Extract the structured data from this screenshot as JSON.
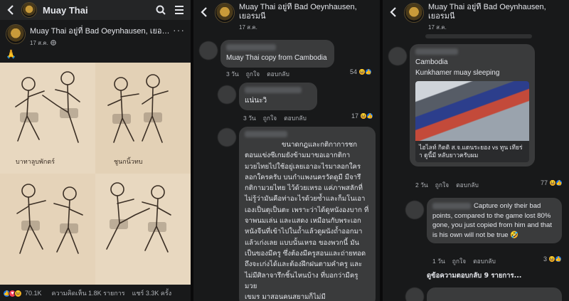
{
  "panel1": {
    "app_title": "Muay Thai",
    "post": {
      "author": "Muay Thai อยู่ที่ Bad Oeynhausen, เยอรมนี",
      "date": "17 ส.ค.",
      "caption": "🙏",
      "art_labels": [
        "บาทาลูบพักตร์",
        "ชูนกนิ้วทบ"
      ]
    },
    "stats": {
      "reactions": "70.1K",
      "comments": "ความคิดเห็น 1.8K รายการ",
      "shares": "แชร์ 3.3K ครั้ง"
    }
  },
  "panel2": {
    "page_name": "Muay Thai อยู่ที่ Bad Oeynhausen, เยอรมนี",
    "date": "17 ส.ค.",
    "comments": [
      {
        "text": "Muay Thai copy from Cambodia",
        "time": "3 วัน",
        "like": "ถูกใจ",
        "reply": "ตอบกลับ",
        "count": "54"
      },
      {
        "text": "แน่นะวิ",
        "time": "3 วัน",
        "like": "ถูกใจ",
        "reply": "ตอบกลับ",
        "count": "17"
      },
      {
        "lines": [
          "ขนาดกฎและกติกาการชก",
          "ตอนแข่งซีเกมยังข้ามมาขอเอากติกา",
          "มวยไทยไปใช้อยู่เลยเอาอะไรมาลอกใคร",
          "ลอกใครครับ บนกำแพงนครวัดดูมี มีจารึ",
          "กติกามวยไทย ไว้ด้วยเหรอ แค่ภาพสลักที่",
          "ไม่รู้ว่ามันคือท่าอะไรด้วยซ้ำและก็มโนเอา",
          "เองเป็นตุเป็นตะ เพราะว่าได้ดูหนังองบาก ที่",
          "จาพนมเล่น และแสดง เหมือนกับพระเอก",
          "หนังจีนที่เข้าไปในถ้ำแล้วดูผนังถ้ำออกมา",
          "แล้วเก่งเลย แบบนั้นเหรอ ของพวกนี้ มัน",
          "เป็นของมีครู ซึ่งต้องมีครูสอนและถ่ายทอด",
          "ถึงจะเก่งได้และต้องฝึกฝนตามคำครู และ",
          "ไม่มีศิลาจารึกชิ้นไหนบ้าง ที่บอกว่ามีครูมวย",
          "เขมร มาสอนคนสยามก็ไม่มี"
        ]
      }
    ]
  },
  "panel3": {
    "page_name": "Muay Thai อยู่ที่ Bad Oeynhausen, เยอรมนี",
    "date": "17 ส.ค.",
    "comments": [
      {
        "line1": "Cambodia",
        "line2": "Kunkhamer muay sleeping",
        "thumb_caption": "ไฮไลท์ กิตติ ส.จ.แดนระยอง vs ทูน เทียร่า ดูนี้มี หลับยาวครับผม",
        "time": "2 วัน",
        "like": "ถูกใจ",
        "reply": "ตอบกลับ",
        "count": "77"
      },
      {
        "text": "Capture only their bad points, compared to the game lost 80% gone, you just copied from him and that is his own will not be true 🤣",
        "time": "1 วัน",
        "like": "ถูกใจ",
        "reply": "ตอบกลับ",
        "count": "3"
      }
    ],
    "more_replies": "ดูข้อความตอบกลับ 9 รายการ..."
  }
}
